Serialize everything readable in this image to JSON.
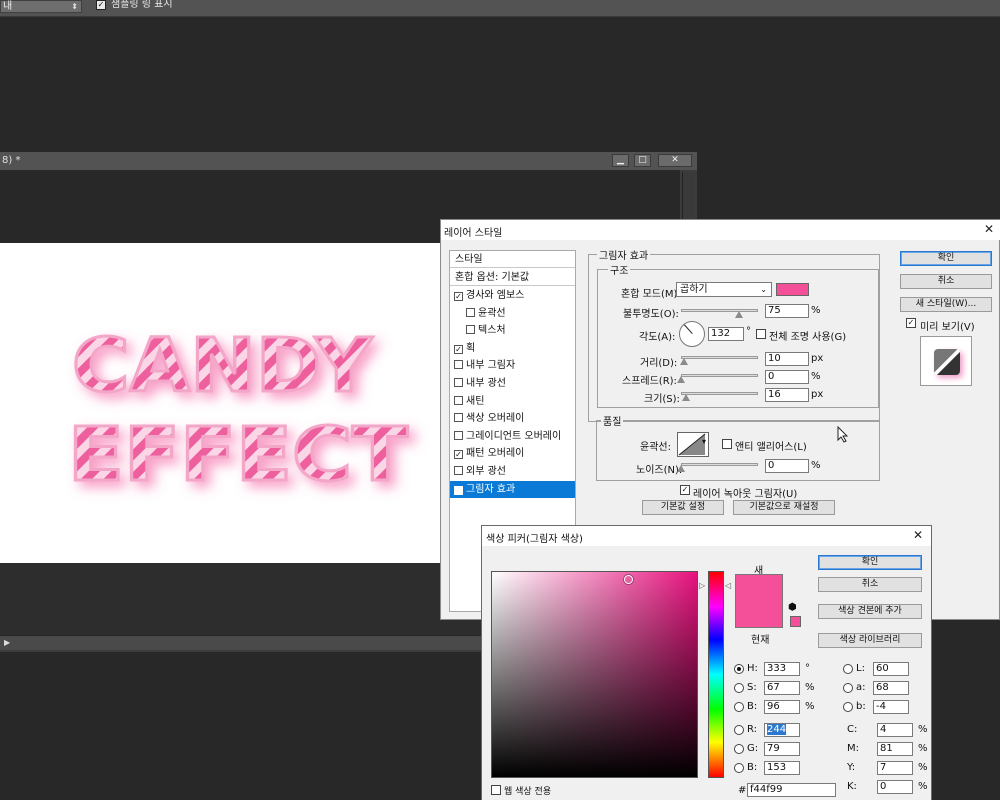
{
  "options_bar": {
    "combo_value": "내",
    "checkbox_label": "샘플링 링 표시",
    "checkbox_checked": true
  },
  "document": {
    "title": "8) *",
    "window_buttons": [
      "▁",
      "□",
      "✕"
    ],
    "canvas_text": [
      "CANDY",
      "EFFECT"
    ],
    "candy_colors": {
      "pink": "#ee5f9e",
      "light": "#fbd6e6"
    }
  },
  "layer_style": {
    "title": "레이어 스타일",
    "styles_header": "스타일",
    "blend_header": "혼합 옵션: 기본값",
    "items": [
      {
        "label": "경사와 엠보스",
        "checked": true,
        "indent": false
      },
      {
        "label": "윤곽선",
        "checked": false,
        "indent": true
      },
      {
        "label": "텍스처",
        "checked": false,
        "indent": true
      },
      {
        "label": "획",
        "checked": true,
        "indent": false
      },
      {
        "label": "내부 그림자",
        "checked": false,
        "indent": false
      },
      {
        "label": "내부 광선",
        "checked": false,
        "indent": false
      },
      {
        "label": "새틴",
        "checked": false,
        "indent": false
      },
      {
        "label": "색상 오버레이",
        "checked": false,
        "indent": false
      },
      {
        "label": "그레이디언트 오버레이",
        "checked": false,
        "indent": false
      },
      {
        "label": "패턴 오버레이",
        "checked": true,
        "indent": false
      },
      {
        "label": "외부 광선",
        "checked": false,
        "indent": false
      },
      {
        "label": "그림자 효과",
        "checked": true,
        "indent": false,
        "selected": true
      }
    ],
    "section_title": "그림자 효과",
    "structure_title": "구조",
    "blend_mode_label": "혼합 모드(M):",
    "blend_mode_value": "곱하기",
    "shadow_color": "#f44f99",
    "opacity_label": "불투명도(O):",
    "opacity_value": "75",
    "opacity_unit": "%",
    "opacity_fraction": 0.75,
    "angle_label": "각도(A):",
    "angle_value": "132",
    "angle_unit": "°",
    "global_light_label": "전체 조명 사용(G)",
    "global_light_checked": false,
    "distance_label": "거리(D):",
    "distance_value": "10",
    "distance_unit": "px",
    "distance_fraction": 0.04,
    "spread_label": "스프레드(R):",
    "spread_value": "0",
    "spread_unit": "%",
    "spread_fraction": 0,
    "size_label": "크기(S):",
    "size_value": "16",
    "size_unit": "px",
    "size_fraction": 0.06,
    "quality_title": "품질",
    "contour_label": "윤곽선:",
    "antialias_label": "앤티 앨리어스(L)",
    "antialias_checked": false,
    "noise_label": "노이즈(N):",
    "noise_value": "0",
    "noise_unit": "%",
    "noise_fraction": 0,
    "knockout_label": "레이어 녹아웃 그림자(U)",
    "knockout_checked": true,
    "default_button": "기본값 설정",
    "reset_button": "기본값으로 재설정",
    "ok_button": "확인",
    "cancel_button": "취소",
    "new_style_button": "새 스타일(W)...",
    "preview_label": "미리 보기(V)",
    "preview_checked": true
  },
  "color_picker": {
    "title": "색상 피커(그림자 색상)",
    "new_label": "새",
    "current_label": "현재",
    "new_color": "#f44f99",
    "current_color": "#f44f99",
    "ok_button": "확인",
    "cancel_button": "취소",
    "add_swatch_button": "색상 견본에 추가",
    "library_button": "색상 라이브러리",
    "hsb": [
      {
        "label": "H:",
        "value": "333",
        "unit": "°",
        "selected": true
      },
      {
        "label": "S:",
        "value": "67",
        "unit": "%",
        "selected": false
      },
      {
        "label": "B:",
        "value": "96",
        "unit": "%",
        "selected": false
      }
    ],
    "lab": [
      {
        "label": "L:",
        "value": "60"
      },
      {
        "label": "a:",
        "value": "68"
      },
      {
        "label": "b:",
        "value": "-4"
      }
    ],
    "rgb": [
      {
        "label": "R:",
        "value": "244",
        "highlighted": true
      },
      {
        "label": "G:",
        "value": "79",
        "highlighted": false
      },
      {
        "label": "B:",
        "value": "153",
        "highlighted": false
      }
    ],
    "cmyk": [
      {
        "label": "C:",
        "value": "4",
        "unit": "%"
      },
      {
        "label": "M:",
        "value": "81",
        "unit": "%"
      },
      {
        "label": "Y:",
        "value": "7",
        "unit": "%"
      },
      {
        "label": "K:",
        "value": "0",
        "unit": "%"
      }
    ],
    "hex_label": "#",
    "hex_value": "f44f99",
    "web_only_label": "웹 색상 전용",
    "web_only_checked": false
  }
}
